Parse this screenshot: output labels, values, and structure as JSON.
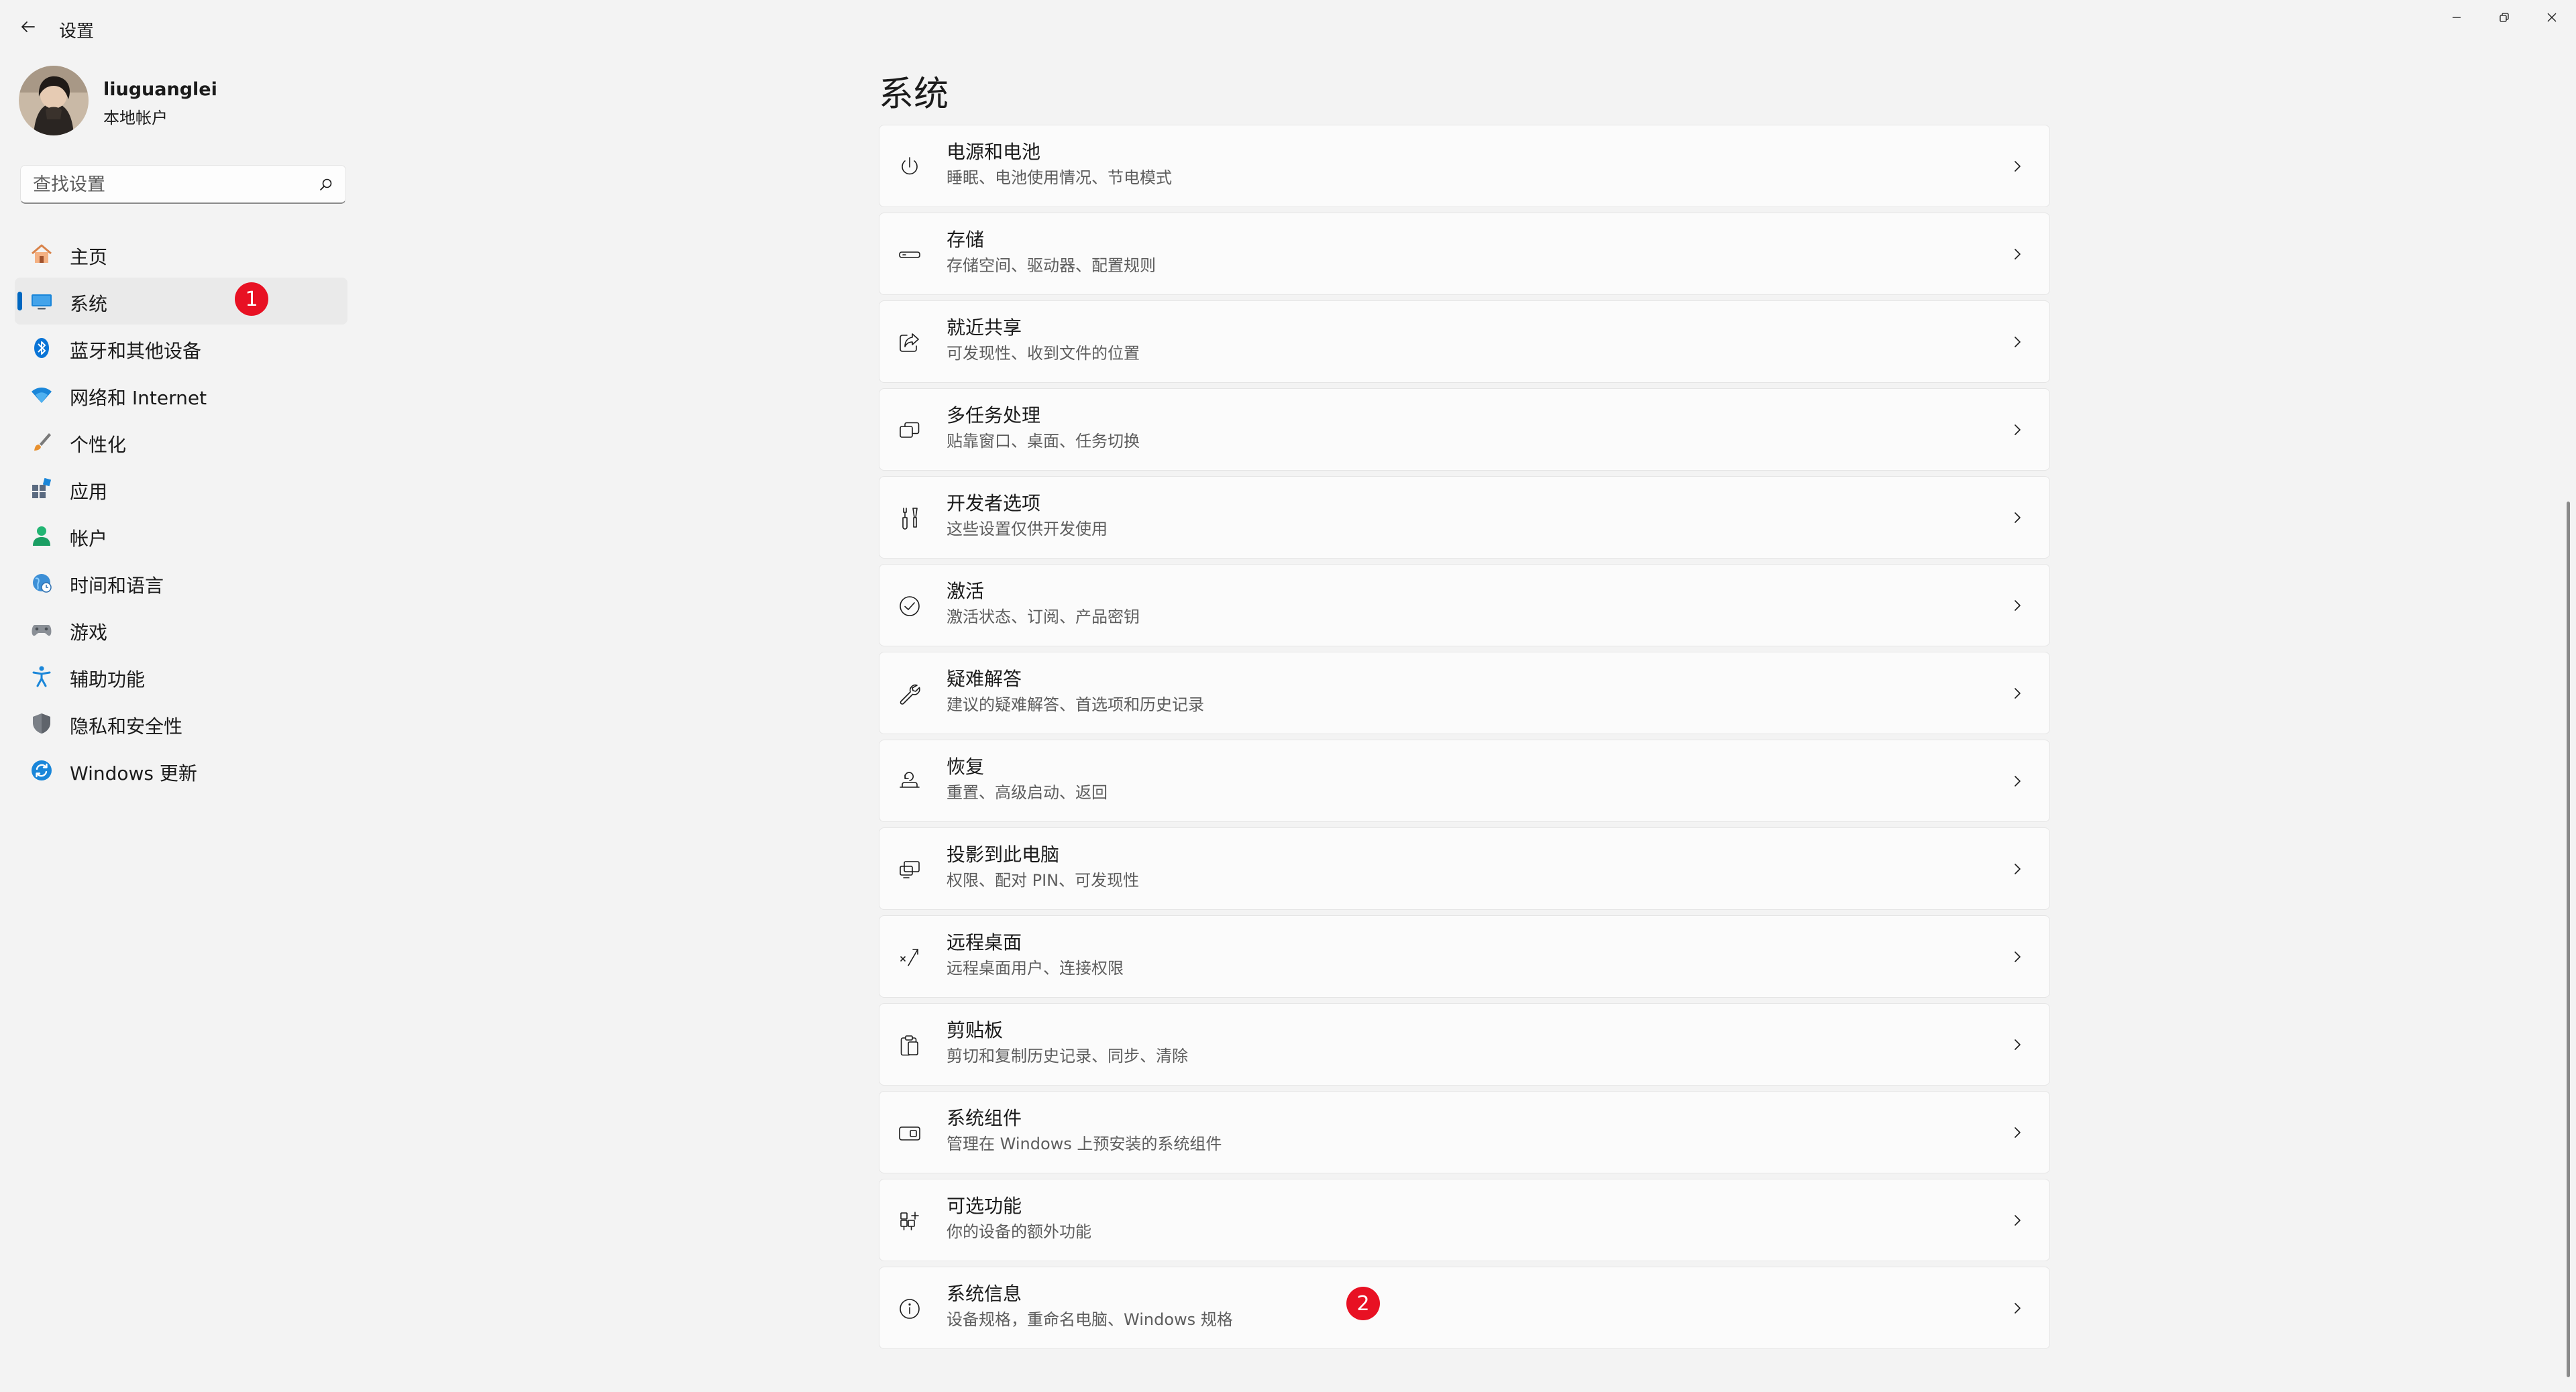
{
  "window": {
    "app_title": "设置"
  },
  "profile": {
    "name": "liuguanglei",
    "account_type": "本地帐户"
  },
  "search": {
    "placeholder": "查找设置"
  },
  "nav": {
    "items": [
      {
        "label": "主页",
        "icon": "home-icon"
      },
      {
        "label": "系统",
        "icon": "monitor-icon",
        "active": true
      },
      {
        "label": "蓝牙和其他设备",
        "icon": "bluetooth-icon"
      },
      {
        "label": "网络和 Internet",
        "icon": "wifi-icon"
      },
      {
        "label": "个性化",
        "icon": "brush-icon"
      },
      {
        "label": "应用",
        "icon": "apps-icon"
      },
      {
        "label": "帐户",
        "icon": "person-icon"
      },
      {
        "label": "时间和语言",
        "icon": "globe-clock-icon"
      },
      {
        "label": "游戏",
        "icon": "gamepad-icon"
      },
      {
        "label": "辅助功能",
        "icon": "accessibility-icon"
      },
      {
        "label": "隐私和安全性",
        "icon": "shield-icon"
      },
      {
        "label": "Windows 更新",
        "icon": "update-icon"
      }
    ]
  },
  "badges": {
    "first": "1",
    "second": "2"
  },
  "main": {
    "title": "系统",
    "cards": [
      {
        "title": "电源和电池",
        "desc": "睡眠、电池使用情况、节电模式",
        "icon": "power-icon"
      },
      {
        "title": "存储",
        "desc": "存储空间、驱动器、配置规则",
        "icon": "storage-icon"
      },
      {
        "title": "就近共享",
        "desc": "可发现性、收到文件的位置",
        "icon": "share-icon"
      },
      {
        "title": "多任务处理",
        "desc": "贴靠窗口、桌面、任务切换",
        "icon": "multitask-icon"
      },
      {
        "title": "开发者选项",
        "desc": "这些设置仅供开发使用",
        "icon": "developer-tools-icon"
      },
      {
        "title": "激活",
        "desc": "激活状态、订阅、产品密钥",
        "icon": "check-circle-icon"
      },
      {
        "title": "疑难解答",
        "desc": "建议的疑难解答、首选项和历史记录",
        "icon": "wrench-icon"
      },
      {
        "title": "恢复",
        "desc": "重置、高级启动、返回",
        "icon": "recovery-icon"
      },
      {
        "title": "投影到此电脑",
        "desc": "权限、配对 PIN、可发现性",
        "icon": "project-icon"
      },
      {
        "title": "远程桌面",
        "desc": "远程桌面用户、连接权限",
        "icon": "remote-desktop-icon"
      },
      {
        "title": "剪贴板",
        "desc": "剪切和复制历史记录、同步、清除",
        "icon": "clipboard-icon"
      },
      {
        "title": "系统组件",
        "desc": "管理在 Windows 上预安装的系统组件",
        "icon": "components-icon"
      },
      {
        "title": "可选功能",
        "desc": "你的设备的额外功能",
        "icon": "add-features-icon"
      },
      {
        "title": "系统信息",
        "desc": "设备规格，重命名电脑、Windows 规格",
        "icon": "info-icon"
      }
    ]
  },
  "colors": {
    "accent": "#0067c0",
    "badge": "#e81123",
    "background": "#f3f3f3",
    "card": "#fbfbfb"
  }
}
